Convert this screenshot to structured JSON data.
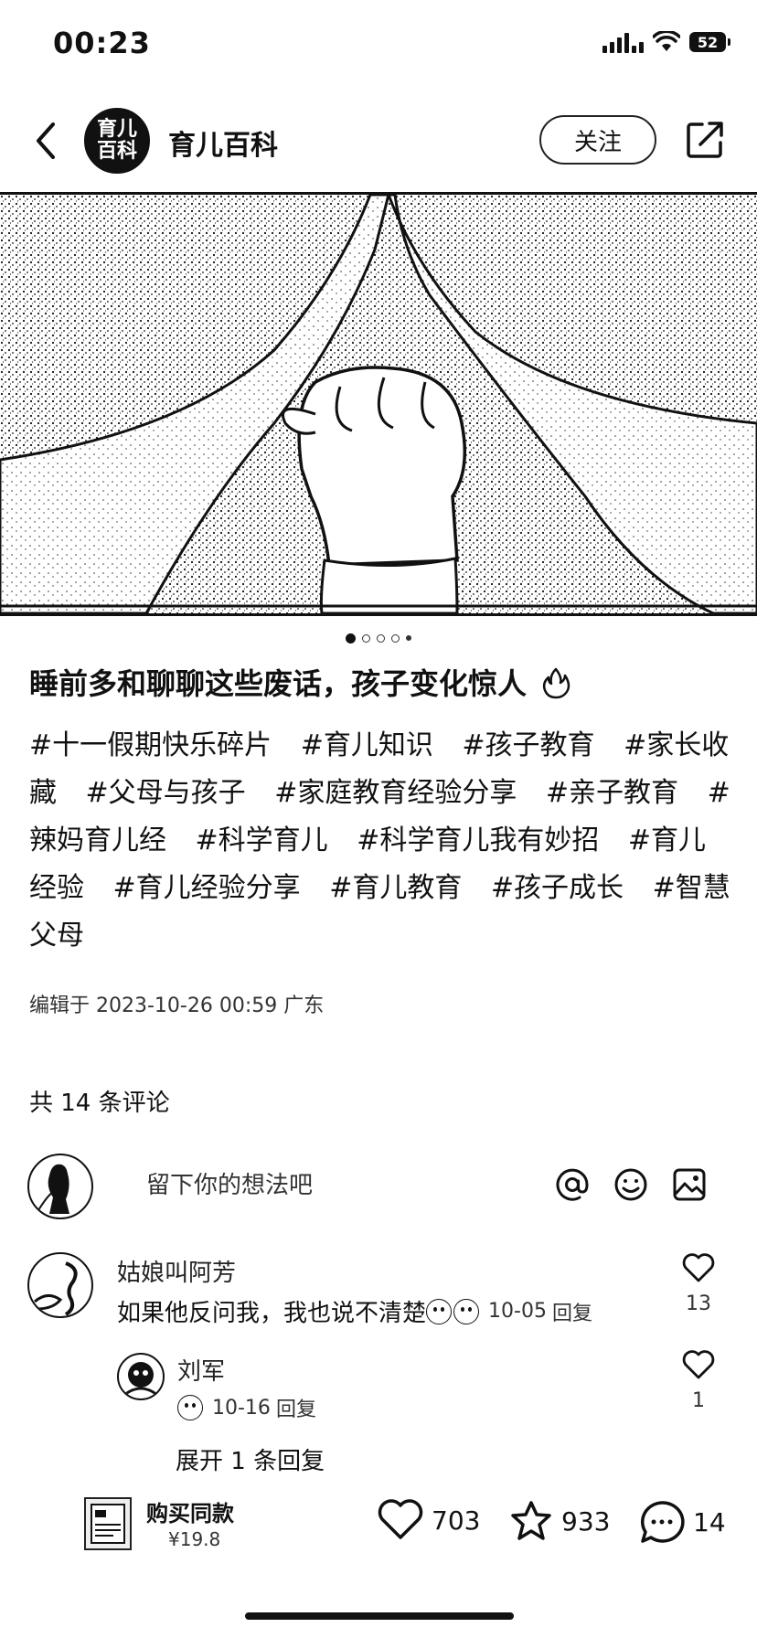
{
  "status_bar": {
    "time": "00:23",
    "battery": "52"
  },
  "header": {
    "account_avatar_text": "育儿百科",
    "account_name": "育儿百科",
    "follow_label": "关注"
  },
  "carousel": {
    "total_pages": 5,
    "current_page": 1
  },
  "post": {
    "title": "睡前多和聊聊这些废话，孩子变化惊人",
    "tags": [
      "#十一假期快乐碎片",
      "#育儿知识",
      "#孩子教育",
      "#家长收藏",
      "#父母与孩子",
      "#家庭教育经验分享",
      "#亲子教育",
      "#辣妈育儿经",
      "#科学育儿",
      "#科学育儿我有妙招",
      "#育儿经验",
      "#育儿经验分享",
      "#育儿教育",
      "#孩子成长",
      "#智慧父母"
    ],
    "edit_info": "编辑于 2023-10-26 00:59 广东"
  },
  "comments_section": {
    "count_label": "共 14 条评论",
    "input_placeholder": "留下你的想法吧"
  },
  "comments": [
    {
      "name": "姑娘叫阿芳",
      "text": "如果他反问我，我也说不清楚",
      "date": "10-05",
      "reply_label": "回复",
      "likes": "13"
    },
    {
      "name": "刘军",
      "text": "",
      "date": "10-16",
      "reply_label": "回复",
      "likes": "1"
    }
  ],
  "expand_replies_label": "展开 1 条回复",
  "bottom_bar": {
    "product_label": "购买同款",
    "product_price": "¥19.8",
    "likes": "703",
    "favorites": "933",
    "comments": "14"
  }
}
